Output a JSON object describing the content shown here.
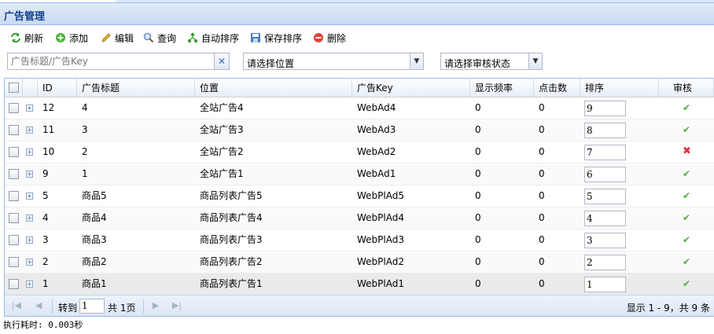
{
  "panel": {
    "title": "广告管理"
  },
  "toolbar": {
    "refresh": "刷新",
    "add": "添加",
    "edit": "编辑",
    "query": "查询",
    "auto_sort": "自动排序",
    "save_sort": "保存排序",
    "delete": "删除"
  },
  "filters": {
    "search_placeholder": "广告标题/广告Key",
    "position_select": "请选择位置",
    "review_select": "请选择审核状态"
  },
  "columns": [
    "ID",
    "广告标题",
    "位置",
    "广告Key",
    "显示频率",
    "点击数",
    "排序",
    "审核"
  ],
  "rows": [
    {
      "id": "12",
      "title": "4",
      "position": "全站广告4",
      "key": "WebAd4",
      "freq": "0",
      "clicks": "0",
      "sort": "9",
      "approved": true
    },
    {
      "id": "11",
      "title": "3",
      "position": "全站广告3",
      "key": "WebAd3",
      "freq": "0",
      "clicks": "0",
      "sort": "8",
      "approved": true
    },
    {
      "id": "10",
      "title": "2",
      "position": "全站广告2",
      "key": "WebAd2",
      "freq": "0",
      "clicks": "0",
      "sort": "7",
      "approved": false
    },
    {
      "id": "9",
      "title": "1",
      "position": "全站广告1",
      "key": "WebAd1",
      "freq": "0",
      "clicks": "0",
      "sort": "6",
      "approved": true
    },
    {
      "id": "5",
      "title": "商品5",
      "position": "商品列表广告5",
      "key": "WebPlAd5",
      "freq": "0",
      "clicks": "0",
      "sort": "5",
      "approved": true
    },
    {
      "id": "4",
      "title": "商品4",
      "position": "商品列表广告4",
      "key": "WebPlAd4",
      "freq": "0",
      "clicks": "0",
      "sort": "4",
      "approved": true
    },
    {
      "id": "3",
      "title": "商品3",
      "position": "商品列表广告3",
      "key": "WebPlAd3",
      "freq": "0",
      "clicks": "0",
      "sort": "3",
      "approved": true
    },
    {
      "id": "2",
      "title": "商品2",
      "position": "商品列表广告2",
      "key": "WebPlAd2",
      "freq": "0",
      "clicks": "0",
      "sort": "2",
      "approved": true
    },
    {
      "id": "1",
      "title": "商品1",
      "position": "商品列表广告1",
      "key": "WebPlAd1",
      "freq": "0",
      "clicks": "0",
      "sort": "1",
      "approved": true
    }
  ],
  "pager": {
    "goto_label": "转到",
    "page_value": "1",
    "total_pages": "共 1页",
    "info": "显示 1 - 9，共 9 条"
  },
  "status": {
    "exec_time": "执行耗时: 0.003秒"
  },
  "icons": {
    "approved": "check-icon",
    "rejected": "cross-icon"
  },
  "colors": {
    "approved": "#4caf3a",
    "rejected": "#e0333a",
    "header_text": "#15428b"
  }
}
